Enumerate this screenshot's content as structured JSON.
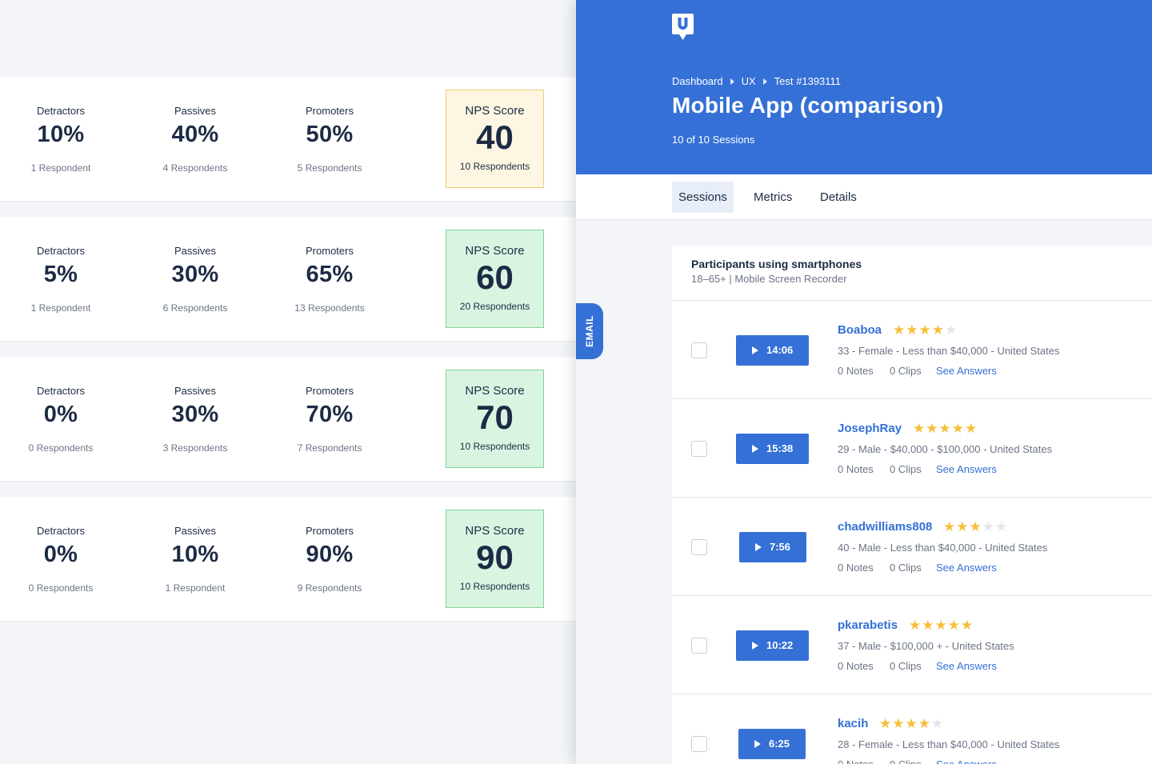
{
  "nps_cards": [
    {
      "detractors": {
        "label": "Detractors",
        "pct": "10%",
        "resp": "1 Respondent"
      },
      "passives": {
        "label": "Passives",
        "pct": "40%",
        "resp": "4 Respondents"
      },
      "promoters": {
        "label": "Promoters",
        "pct": "50%",
        "resp": "5 Respondents"
      },
      "score": {
        "label": "NPS Score",
        "value": "40",
        "resp": "10 Respondents"
      },
      "score_bg": "#fdf6e3",
      "score_border": "#f2cd72"
    },
    {
      "detractors": {
        "label": "Detractors",
        "pct": "5%",
        "resp": "1 Respondent"
      },
      "passives": {
        "label": "Passives",
        "pct": "30%",
        "resp": "6 Respondents"
      },
      "promoters": {
        "label": "Promoters",
        "pct": "65%",
        "resp": "13 Respondents"
      },
      "score": {
        "label": "NPS Score",
        "value": "60",
        "resp": "20 Respondents"
      },
      "score_bg": "#d9f5e2",
      "score_border": "#7fd296"
    },
    {
      "detractors": {
        "label": "Detractors",
        "pct": "0%",
        "resp": "0 Respondents"
      },
      "passives": {
        "label": "Passives",
        "pct": "30%",
        "resp": "3 Respondents"
      },
      "promoters": {
        "label": "Promoters",
        "pct": "70%",
        "resp": "7 Respondents"
      },
      "score": {
        "label": "NPS Score",
        "value": "70",
        "resp": "10 Respondents"
      },
      "score_bg": "#d9f5e2",
      "score_border": "#7fd296"
    },
    {
      "detractors": {
        "label": "Detractors",
        "pct": "0%",
        "resp": "0 Respondents"
      },
      "passives": {
        "label": "Passives",
        "pct": "10%",
        "resp": "1 Respondent"
      },
      "promoters": {
        "label": "Promoters",
        "pct": "90%",
        "resp": "9 Respondents"
      },
      "score": {
        "label": "NPS Score",
        "value": "90",
        "resp": "10 Respondents"
      },
      "score_bg": "#d9f5e2",
      "score_border": "#7fd296"
    }
  ],
  "header": {
    "logo_icon": "usertesting-logo-icon",
    "breadcrumbs": [
      "Dashboard",
      "UX",
      "Test #1393111"
    ],
    "title": "Mobile App (comparison)",
    "sessions_count": "10 of 10 Sessions",
    "bg_color": "#3470d6"
  },
  "tabs": [
    "Sessions",
    "Metrics",
    "Details"
  ],
  "active_tab": "Sessions",
  "email_tab": "EMAIL",
  "list": {
    "title": "Participants using smartphones",
    "subtitle": "18–65+ | Mobile Screen Recorder"
  },
  "sessions": [
    {
      "duration": "14:06",
      "name": "Boaboa",
      "rating": 4,
      "demo": "33 - Female - Less than $40,000 - United States",
      "notes": "0 Notes",
      "clips": "0 Clips",
      "answers": "See Answers"
    },
    {
      "duration": "15:38",
      "name": "JosephRay",
      "rating": 5,
      "demo": "29 - Male - $40,000 - $100,000 - United States",
      "notes": "0 Notes",
      "clips": "0 Clips",
      "answers": "See Answers"
    },
    {
      "duration": "7:56",
      "name": "chadwilliams808",
      "rating": 3,
      "demo": "40 - Male - Less than $40,000 - United States",
      "notes": "0 Notes",
      "clips": "0 Clips",
      "answers": "See Answers"
    },
    {
      "duration": "10:22",
      "name": "pkarabetis",
      "rating": 5,
      "demo": "37 - Male - $100,000 + - United States",
      "notes": "0 Notes",
      "clips": "0 Clips",
      "answers": "See Answers"
    },
    {
      "duration": "6:25",
      "name": "kacih",
      "rating": 4,
      "demo": "28 - Female - Less than $40,000 - United States",
      "notes": "0 Notes",
      "clips": "0 Clips",
      "answers": "See Answers"
    }
  ]
}
